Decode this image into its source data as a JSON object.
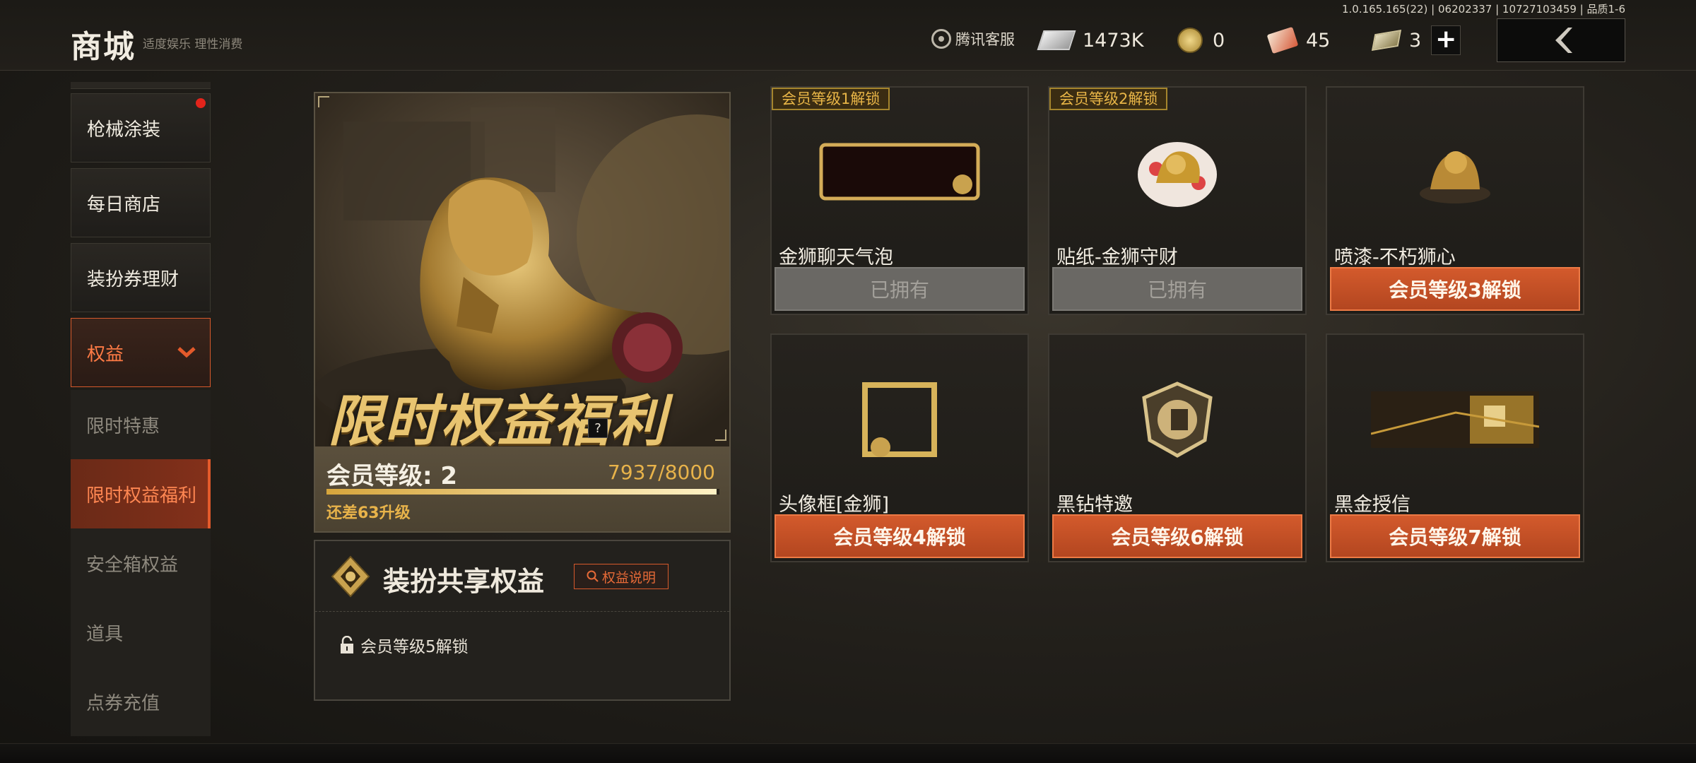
{
  "build_info": "1.0.165.165(22) | 06202337 | 10727103459 | 品质1-6",
  "header": {
    "title": "商城",
    "subtitle": "适度娱乐 理性消费",
    "customer_service": "腾讯客服",
    "currencies": [
      {
        "icon": "cash-icon",
        "value": "1473K"
      },
      {
        "icon": "coin-icon",
        "value": "0"
      },
      {
        "icon": "ticket-icon",
        "value": "45"
      },
      {
        "icon": "bill-icon",
        "value": "3"
      }
    ],
    "add_label": "+"
  },
  "sidebar": {
    "items": [
      {
        "label": "枪械涂装",
        "type": "main",
        "notify": true
      },
      {
        "label": "每日商店",
        "type": "main"
      },
      {
        "label": "装扮券理财",
        "type": "main"
      },
      {
        "label": "权益",
        "type": "main",
        "expanded": true
      },
      {
        "label": "限时特惠",
        "type": "sub"
      },
      {
        "label": "限时权益福利",
        "type": "sub",
        "active": true
      },
      {
        "label": "安全箱权益",
        "type": "sub"
      },
      {
        "label": "道具",
        "type": "sub"
      },
      {
        "label": "点券充值",
        "type": "sub"
      }
    ]
  },
  "feature": {
    "title": "限时权益福利",
    "help": "?",
    "level_label": "会员等级: 2",
    "progress_text": "7937/8000",
    "progress_fraction": 0.992,
    "remaining": "还差63升级"
  },
  "share": {
    "title": "装扮共享权益",
    "rights_button": "权益说明",
    "lock_text": "会员等级5解锁"
  },
  "cards": [
    {
      "badge": "会员等级1解锁",
      "name": "金狮聊天气泡",
      "button": "已拥有",
      "owned": true,
      "art": "chat-bubble"
    },
    {
      "badge": "会员等级2解锁",
      "name": "贴纸-金狮守财",
      "button": "已拥有",
      "owned": true,
      "art": "sticker"
    },
    {
      "badge": "",
      "name": "喷漆-不朽狮心",
      "button": "会员等级3解锁",
      "owned": false,
      "art": "spray"
    },
    {
      "badge": "",
      "name": "头像框[金狮]",
      "button": "会员等级4解锁",
      "owned": false,
      "art": "frame"
    },
    {
      "badge": "",
      "name": "黑钻特邀",
      "button": "会员等级6解锁",
      "owned": false,
      "art": "emblem"
    },
    {
      "badge": "",
      "name": "黑金授信",
      "button": "会员等级7解锁",
      "owned": false,
      "art": "card"
    }
  ]
}
